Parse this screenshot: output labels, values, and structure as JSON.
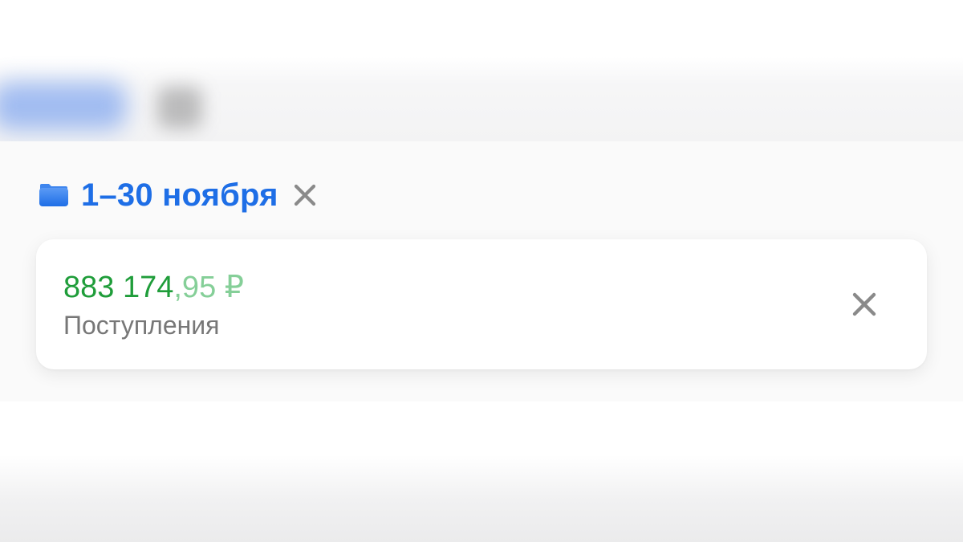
{
  "filter": {
    "period_label": "1–30 ноября",
    "folder_icon": "folder-icon",
    "clear_icon": "close-icon",
    "accent_color": "#1e6ee6"
  },
  "summary_card": {
    "amount_integer": "883 174",
    "amount_fraction": ",95 ₽",
    "label": "Поступления",
    "amount_color": "#1f9d3a",
    "close_icon": "close-icon"
  }
}
